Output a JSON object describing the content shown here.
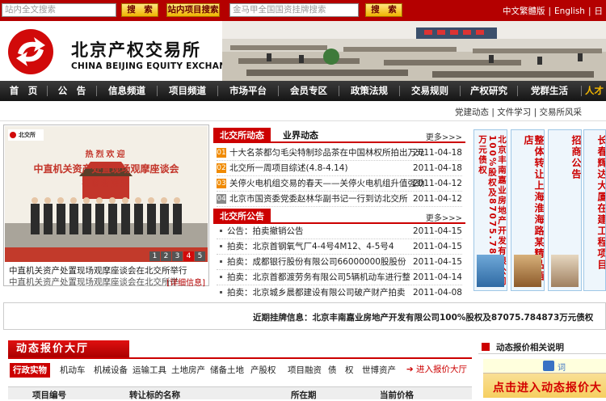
{
  "topbar": {
    "site_search_placeholder": "站内全文搜索",
    "search_label": "搜　索",
    "project_search_label": "站内项目搜索",
    "project_search_placeholder": "金马甲全国国资挂牌搜索",
    "search2_label": "搜　索",
    "lang_traditional": "中文繁體版",
    "lang_english": "English",
    "lang_third": "日"
  },
  "header": {
    "logo_cn": "北京产权交易所",
    "logo_en": "CHINA BEIJING EQUITY EXCHANGE"
  },
  "nav": {
    "items": [
      "首　页",
      "公　告",
      "信息频道",
      "项目频道",
      "市场平台",
      "会员专区",
      "政策法规",
      "交易规则",
      "产权研究",
      "党群生活",
      "人才"
    ]
  },
  "subnav": {
    "links": [
      "党建动态",
      "文件学习",
      "交易所风采"
    ]
  },
  "slideshow": {
    "caption_primary": "中直机关资产处置现场观摩座谈会在北交所举行",
    "caption_secondary": "中直机关资产处置现场观摩座谈会在北交所举",
    "details_label": "[详细信息]",
    "pages": [
      "1",
      "2",
      "3",
      "4",
      "5"
    ],
    "active_page": "4",
    "banner_line1": "热烈欢迎",
    "banner_line2": "中直机关资产处置现场观摩座谈会",
    "banner_line3": "莅临北交所",
    "badge_text": "北交所"
  },
  "news_panel": {
    "tab_active": "北交所动态",
    "tab_other": "业界动态",
    "more_label": "更多>>>",
    "items": [
      {
        "rank": "01",
        "title": "十大名茶都匀毛尖特制珍品茶在中国林权所拍出万元",
        "date": "2011-04-18"
      },
      {
        "rank": "02",
        "title": "北交所一周项目综述(4.8-4.14)",
        "date": "2011-04-18"
      },
      {
        "rank": "03",
        "title": "关停火电机组交易的春天——关停火电机组升值强劲",
        "date": "2011-04-12"
      },
      {
        "rank": "04",
        "title": "北京市国资委党委赵林华副书记一行到访北交所",
        "date": "2011-04-12"
      }
    ]
  },
  "notice_panel": {
    "tab_active": "北交所公告",
    "more_label": "更多>>>",
    "items": [
      {
        "title": "公告：拍卖撤销公告",
        "date": "2011-04-15"
      },
      {
        "title": "拍卖：北京首钢氧气厂4-4号4M12、4-5号4",
        "date": "2011-04-15"
      },
      {
        "title": "拍卖：成都银行股份有限公司66000000股股份",
        "date": "2011-04-15"
      },
      {
        "title": "拍卖：北京首都渡劳务有限公司5辆机动车进行整体打包",
        "date": "2011-04-14"
      },
      {
        "title": "拍卖：北京城乡晨都建设有限公司破产财产拍卖",
        "date": "2011-04-08"
      }
    ]
  },
  "ads": [
    {
      "text": "北京丰南嘉业房地产开发有限公司100%股权及87075.784873万元债权"
    },
    {
      "text": "整体转让上海淮海路某精品酒店"
    },
    {
      "text": "招商公告"
    },
    {
      "text": "长春辉达大厦在建工程项目"
    }
  ],
  "ticker": {
    "text": "近期挂牌信息：北京丰南嘉业房地产开发有限公司100%股权及87075.784873万元债权",
    "text_tail": "北京"
  },
  "board": {
    "title": "动态报价大厅",
    "tabs": [
      "行政实物",
      "机动车",
      "机械设备",
      "运输工具",
      "土地房产",
      "储备土地",
      "产股权",
      "项目融资",
      "债　权",
      "世博资产"
    ],
    "into_label": "进入报价大厅",
    "columns": [
      "项目编号",
      "转让标的名称",
      "所在期",
      "当前价格"
    ]
  },
  "side": {
    "title": "动态报价相关说明",
    "ad_text": "点击进入动态报价大",
    "ad_small": "词"
  },
  "colors": {
    "brand_red": "#c00000",
    "topbar_red": "#b40000",
    "nav_dark": "#1f1f1f",
    "button_gold": "#f0b400"
  }
}
